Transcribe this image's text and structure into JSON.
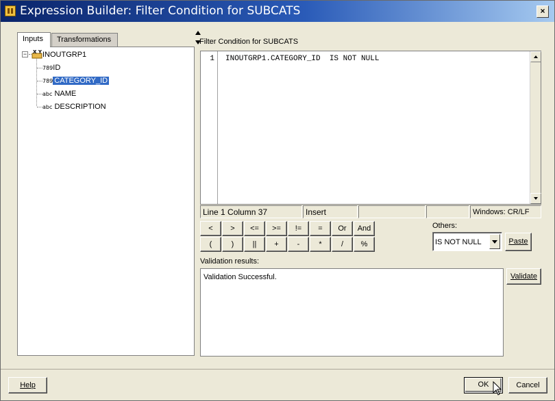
{
  "window": {
    "title": "Expression Builder: Filter Condition for SUBCATS",
    "close_glyph": "×"
  },
  "tabs": [
    {
      "label": "Inputs",
      "active": true
    },
    {
      "label": "Transformations",
      "active": false
    }
  ],
  "tree": {
    "group": {
      "label": "INOUTGRP1",
      "icon": "input-group-icon",
      "expanded": true
    },
    "attributes": [
      {
        "label": "ID",
        "type_glyph": "789",
        "icon": "numeric-type-icon",
        "selected": false
      },
      {
        "label": "CATEGORY_ID",
        "type_glyph": "789",
        "icon": "numeric-type-icon",
        "selected": true
      },
      {
        "label": "NAME",
        "type_glyph": "abc",
        "icon": "text-type-icon",
        "selected": false
      },
      {
        "label": "DESCRIPTION",
        "type_glyph": "abc",
        "icon": "text-type-icon",
        "selected": false
      }
    ]
  },
  "editor": {
    "label": "Filter Condition for SUBCATS",
    "line_number": "1",
    "code": "INOUTGRP1.CATEGORY_ID  IS NOT NULL"
  },
  "status": {
    "position": "Line 1 Column 37",
    "mode": "Insert",
    "cell3": "",
    "cell4": "",
    "line_ending": "Windows: CR/LF"
  },
  "operators": {
    "row1": [
      "<",
      ">",
      "<=",
      ">=",
      "!=",
      "=",
      "Or",
      "And"
    ],
    "row2": [
      "(",
      ")",
      "||",
      "+",
      "-",
      "*",
      "/",
      "%"
    ]
  },
  "others": {
    "label": "Others:",
    "selected": "IS NOT NULL",
    "paste_label": "Paste"
  },
  "validation": {
    "label": "Validation results:",
    "result": "Validation Successful.",
    "validate_label": "Validate"
  },
  "footer": {
    "help_label": "Help",
    "ok_label": "OK",
    "cancel_label": "Cancel"
  },
  "colors": {
    "title_start": "#0a246a",
    "title_end": "#a6caf0",
    "selection": "#316ac5",
    "window_bg": "#ece9d8"
  }
}
